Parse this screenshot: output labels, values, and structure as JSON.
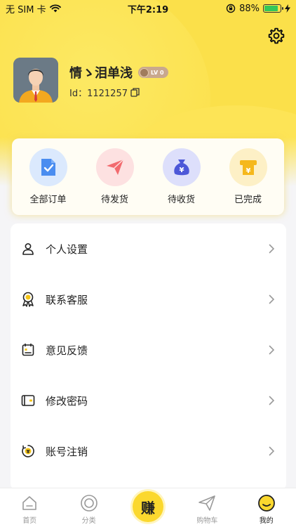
{
  "status_bar": {
    "carrier": "无 SIM 卡",
    "time": "下午2:19",
    "battery": "88%",
    "battery_level": 0.88
  },
  "profile": {
    "nickname": "情ゝ泪单浅",
    "level": "LV 0",
    "id_label": "Id：1121257"
  },
  "orders": [
    {
      "label": "全部订单",
      "icon": "clipboard-check-icon",
      "color": "#4a8df0",
      "bg": "#dbe9fd"
    },
    {
      "label": "待发货",
      "icon": "paper-plane-icon",
      "color": "#f26a6e",
      "bg": "#fde1e1"
    },
    {
      "label": "待收货",
      "icon": "money-bag-icon",
      "color": "#4c57d8",
      "bg": "#dddffb"
    },
    {
      "label": "已完成",
      "icon": "ticket-icon",
      "color": "#f5b81c",
      "bg": "#fdf0c6"
    }
  ],
  "menu": [
    {
      "label": "个人设置",
      "icon": "person-icon"
    },
    {
      "label": "联系客服",
      "icon": "award-ribbon-icon"
    },
    {
      "label": "意见反馈",
      "icon": "feedback-icon"
    },
    {
      "label": "修改密码",
      "icon": "wallet-key-icon"
    },
    {
      "label": "账号注销",
      "icon": "yen-coin-icon"
    }
  ],
  "tabs": [
    {
      "label": "首页",
      "icon": "home-icon"
    },
    {
      "label": "分类",
      "icon": "category-circle-icon"
    },
    {
      "label": "赚",
      "icon": "earn-button"
    },
    {
      "label": "购物车",
      "icon": "paper-plane-icon"
    },
    {
      "label": "我的",
      "icon": "smiley-icon"
    }
  ]
}
